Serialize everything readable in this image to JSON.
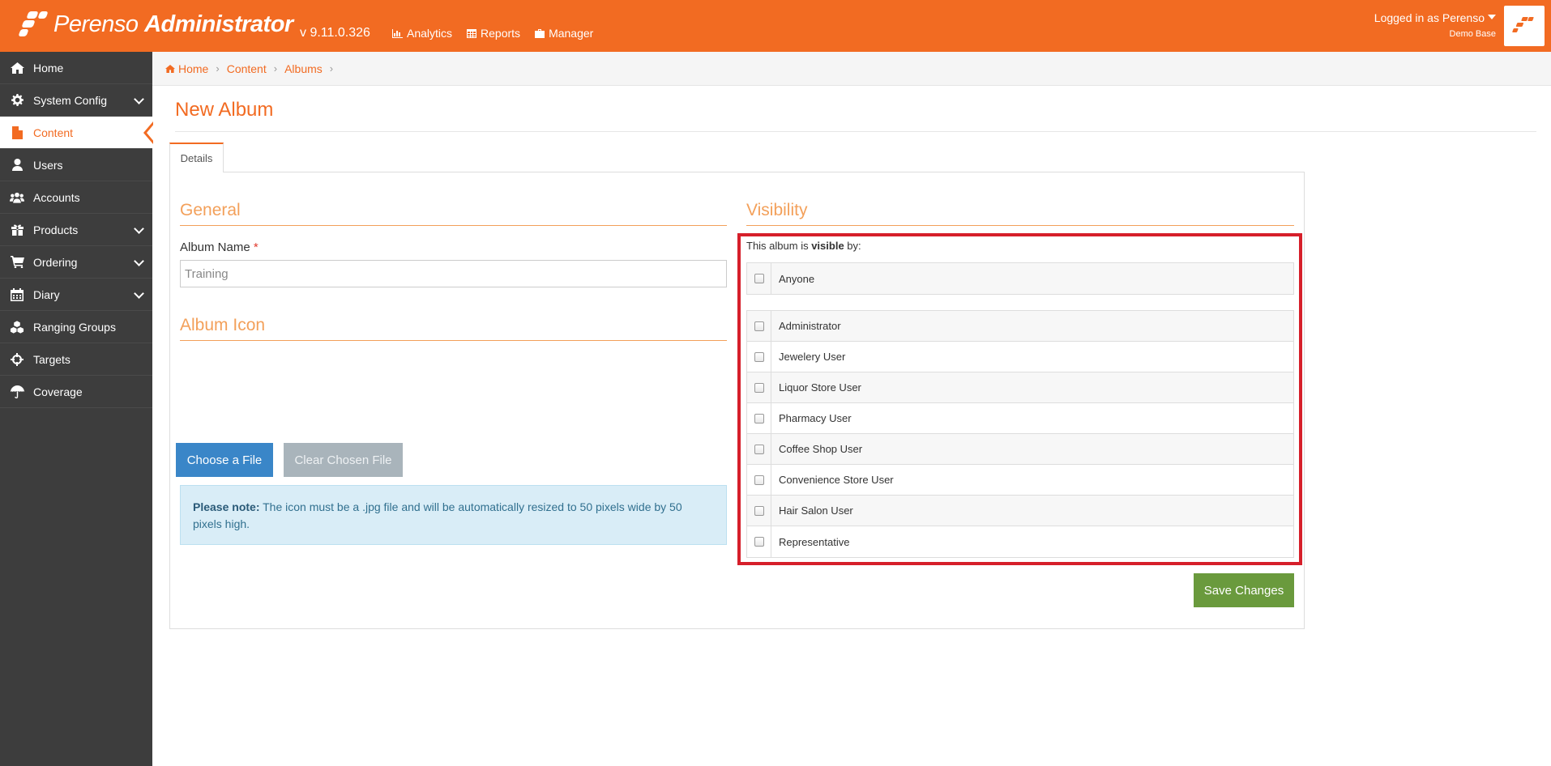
{
  "app": {
    "brand_light": "Perenso",
    "brand_bold": "Administrator",
    "version": "v 9.11.0.326",
    "accent_color": "#f26b22"
  },
  "topnav": [
    {
      "label": "Analytics",
      "icon": "bar-chart-icon"
    },
    {
      "label": "Reports",
      "icon": "table-icon"
    },
    {
      "label": "Manager",
      "icon": "briefcase-icon"
    }
  ],
  "user": {
    "logged_in": "Logged in as Perenso",
    "database": "Demo Base"
  },
  "sidebar": {
    "items": [
      {
        "label": "Home",
        "icon": "home-icon"
      },
      {
        "label": "System Config",
        "icon": "gear-icon"
      },
      {
        "label": "Content",
        "icon": "file-icon"
      },
      {
        "label": "Users",
        "icon": "user-icon"
      },
      {
        "label": "Accounts",
        "icon": "users-icon"
      },
      {
        "label": "Products",
        "icon": "gift-icon"
      },
      {
        "label": "Ordering",
        "icon": "cart-icon"
      },
      {
        "label": "Diary",
        "icon": "calendar-icon"
      },
      {
        "label": "Ranging Groups",
        "icon": "cubes-icon"
      },
      {
        "label": "Targets",
        "icon": "crosshairs-icon"
      },
      {
        "label": "Coverage",
        "icon": "umbrella-icon"
      }
    ]
  },
  "breadcrumb": [
    "Home",
    "Content",
    "Albums"
  ],
  "page": {
    "title": "New Album",
    "tab": "Details"
  },
  "general": {
    "title": "General",
    "album_name_label": "Album Name",
    "required_mark": "*",
    "album_name_value": "Training"
  },
  "album_icon": {
    "title": "Album Icon",
    "choose_label": "Choose a File",
    "clear_label": "Clear Chosen File",
    "note_strong": "Please note:",
    "note_text": " The icon must be a .jpg file and will be automatically resized to 50 pixels wide by 50 pixels high."
  },
  "visibility": {
    "title": "Visibility",
    "intro_pre": "This album is ",
    "intro_bold": "visible",
    "intro_post": " by:",
    "anyone": "Anyone",
    "roles": [
      "Administrator",
      "Jewelery User",
      "Liquor Store User",
      "Pharmacy User",
      "Coffee Shop User",
      "Convenience Store User",
      "Hair Salon User",
      "Representative"
    ]
  },
  "save_label": "Save Changes"
}
